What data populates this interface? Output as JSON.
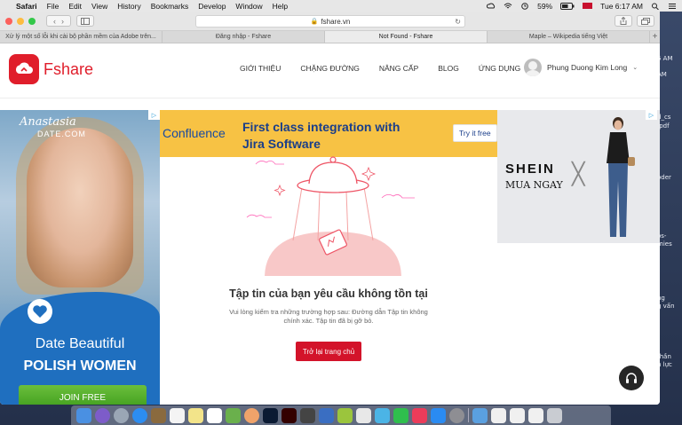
{
  "menubar": {
    "app": "Safari",
    "menus": [
      "File",
      "Edit",
      "View",
      "History",
      "Bookmarks",
      "Develop",
      "Window",
      "Help"
    ],
    "battery": "59%",
    "clock": "Tue 6:17 AM"
  },
  "browser": {
    "url": "fshare.vn",
    "tabs": [
      "Xử lý một số lỗi khi cài bộ phần mềm của Adobe trên...",
      "Đăng nhập - Fshare",
      "Not Found - Fshare",
      "Maple – Wikipedia tiếng Việt"
    ],
    "active_tab": 2
  },
  "site": {
    "logo_text": "Fshare",
    "nav": [
      "GIỚI THIỆU",
      "CHẶNG ĐƯỜNG",
      "NÂNG CẤP",
      "BLOG",
      "ỨNG DỤNG"
    ],
    "user_name": "Phung Duong Kim Long",
    "accent": "#e01e2b"
  },
  "ads": {
    "left": {
      "brand": "AnastasiaDate.com",
      "line1": "Date Beautiful",
      "line2": "POLISH WOMEN",
      "cta": "JOIN FREE"
    },
    "top": {
      "brand": "Confluence",
      "message": "First class integration with Jira Software",
      "cta": "Try it free"
    },
    "right": {
      "brand": "SHEIN",
      "tagline": "MUA NGAY"
    }
  },
  "not_found": {
    "title": "Tập tin của bạn yêu cầu không tồn tại",
    "description": "Vui lòng kiểm tra những trường hợp sau: Đường dẫn Tập tin không chính xác. Tập tin đã bị gỡ bỏ.",
    "button": "Trở lại trang chủ"
  },
  "desktop_files": [
    "5 AM",
    "AM",
    "d_cs",
    ".pdf",
    "oder",
    "os-",
    "mies",
    "ng",
    "g vấn",
    "thần",
    "n lực"
  ]
}
